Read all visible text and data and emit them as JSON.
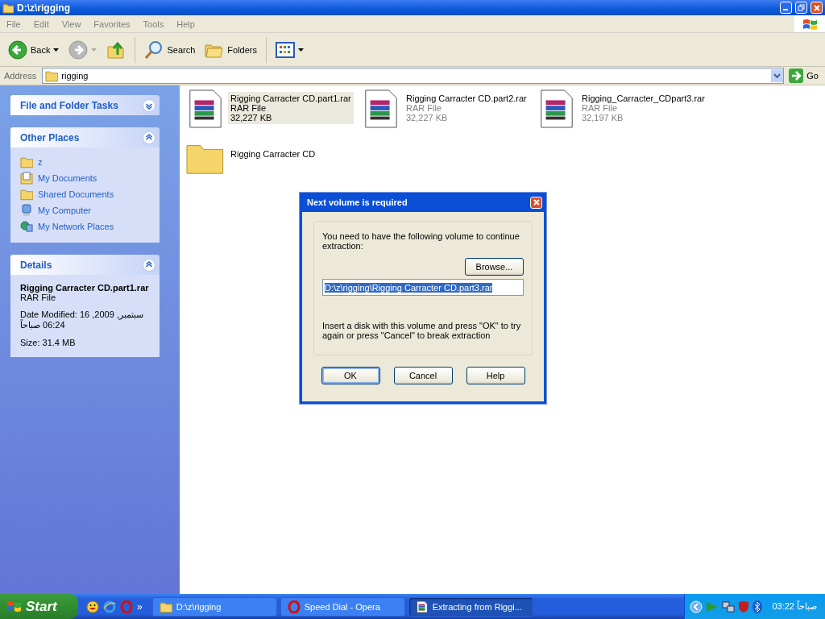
{
  "window": {
    "title": "D:\\z\\rigging"
  },
  "menu": [
    "File",
    "Edit",
    "View",
    "Favorites",
    "Tools",
    "Help"
  ],
  "toolbar": [
    {
      "kind": "back",
      "label": "Back"
    },
    {
      "kind": "forward"
    },
    {
      "kind": "up"
    },
    {
      "kind": "search",
      "label": "Search"
    },
    {
      "kind": "folders",
      "label": "Folders"
    },
    {
      "kind": "views"
    }
  ],
  "address": {
    "label": "Address",
    "value": "rigging",
    "go": "Go"
  },
  "sidebar": {
    "panels": [
      {
        "title": "File and Folder Tasks",
        "expanded": false
      },
      {
        "title": "Other Places",
        "expanded": true,
        "items": [
          {
            "kind": "folder",
            "label": "z"
          },
          {
            "kind": "documents",
            "label": "My Documents"
          },
          {
            "kind": "folder",
            "label": "Shared Documents"
          },
          {
            "kind": "computer",
            "label": "My Computer"
          },
          {
            "kind": "network",
            "label": "My Network Places"
          }
        ]
      },
      {
        "title": "Details",
        "expanded": true,
        "details": {
          "name": "Rigging Carracter CD.part1.rar",
          "type": "RAR File",
          "modified": "Date Modified: 16 سبتمبر, 2009, 06:24 صباحاً",
          "size": "Size: 31.4 MB"
        }
      }
    ]
  },
  "files": [
    {
      "kind": "rar",
      "name": "Rigging Carracter CD.part1.rar",
      "type": "RAR File",
      "size": "32,227 KB",
      "selected": true
    },
    {
      "kind": "rar",
      "name": "Rigging Carracter CD.part2.rar",
      "type": "RAR File",
      "size": "32,227 KB",
      "selected": false
    },
    {
      "kind": "rar",
      "name": "Rigging_Carracter_CDpart3.rar",
      "type": "RAR File",
      "size": "32,197 KB",
      "selected": false
    },
    {
      "kind": "folder",
      "name": "Rigging Carracter CD",
      "selected": false
    }
  ],
  "dialog": {
    "title": "Next volume is required",
    "message": "You need to have the following volume to continue extraction:",
    "browse": "Browse...",
    "path": "D:\\z\\rigging\\Rigging Carracter CD.part3.rar",
    "note": "Insert a disk with this volume and press \"OK\" to try again or press \"Cancel\" to break extraction",
    "buttons": [
      {
        "label": "OK",
        "default": true
      },
      {
        "label": "Cancel",
        "default": false
      },
      {
        "label": "Help",
        "default": false
      }
    ]
  },
  "taskbar": {
    "start": "Start",
    "quicklaunch": [
      {
        "kind": "smiley"
      },
      {
        "kind": "ie"
      },
      {
        "kind": "opera"
      }
    ],
    "more": "»",
    "tasks": [
      {
        "kind": "folder",
        "label": "D:\\z\\rigging",
        "selected": false
      },
      {
        "kind": "opera",
        "label": "Speed Dial - Opera",
        "selected": false
      },
      {
        "kind": "rar",
        "label": "Extracting from Riggi...",
        "selected": true
      }
    ],
    "clock": "03:22 صباحاً"
  }
}
